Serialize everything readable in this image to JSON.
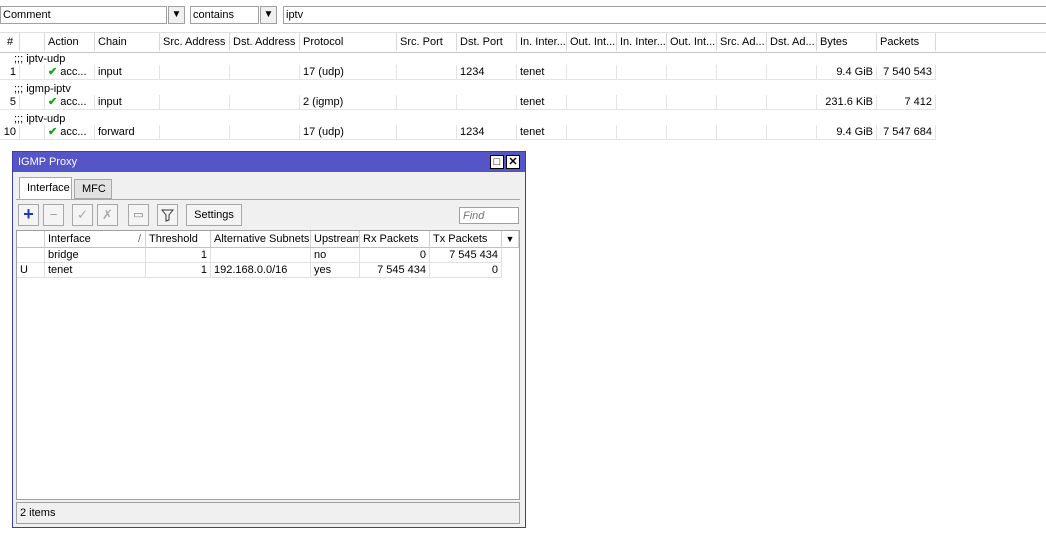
{
  "filter": {
    "field": "Comment",
    "operator": "contains",
    "value": "iptv"
  },
  "table": {
    "columns": [
      "#",
      "Action",
      "Chain",
      "Src. Address",
      "Dst. Address",
      "Protocol",
      "Src. Port",
      "Dst. Port",
      "In. Inter...",
      "Out. Int...",
      "In. Inter...",
      "Out. Int...",
      "Src. Ad...",
      "Dst. Ad...",
      "Bytes",
      "Packets"
    ],
    "comments": [
      ";;; iptv-udp",
      ";;; igmp-iptv",
      ";;; iptv-udp"
    ],
    "rows": [
      {
        "num": "1",
        "action": "acc...",
        "chain": "input",
        "protocol": "17 (udp)",
        "dst_port": "1234",
        "in_interface": "tenet",
        "bytes": "9.4 GiB",
        "packets": "7 540 543"
      },
      {
        "num": "5",
        "action": "acc...",
        "chain": "input",
        "protocol": "2 (igmp)",
        "dst_port": "",
        "in_interface": "tenet",
        "bytes": "231.6 KiB",
        "packets": "7 412"
      },
      {
        "num": "10",
        "action": "acc...",
        "chain": "forward",
        "protocol": "17 (udp)",
        "dst_port": "1234",
        "in_interface": "tenet",
        "bytes": "9.4 GiB",
        "packets": "7 547 684"
      }
    ]
  },
  "igmp_window": {
    "title": "IGMP Proxy",
    "tabs": [
      "Interface",
      "MFC"
    ],
    "settings_label": "Settings",
    "find_placeholder": "Find",
    "columns": [
      "Interface",
      "Threshold",
      "Alternative Subnets",
      "Upstream",
      "Rx Packets",
      "Tx Packets"
    ],
    "rows": [
      {
        "flag": "",
        "interface": "bridge",
        "threshold": "1",
        "alt_subnets": "",
        "upstream": "no",
        "rx": "0",
        "tx": "7 545 434"
      },
      {
        "flag": "U",
        "interface": "tenet",
        "threshold": "1",
        "alt_subnets": "192.168.0.0/16",
        "upstream": "yes",
        "rx": "7 545 434",
        "tx": "0"
      }
    ],
    "status": "2 items"
  },
  "colors": {
    "titlebar": "#5555c8",
    "check": "#1aa01a",
    "add_icon": "#1a3ab4"
  },
  "icons": [
    "dropdown-arrow-icon",
    "check-icon",
    "add-icon",
    "remove-icon",
    "enable-icon",
    "disable-icon",
    "comment-icon",
    "filter-icon",
    "restore-icon",
    "close-icon"
  ]
}
